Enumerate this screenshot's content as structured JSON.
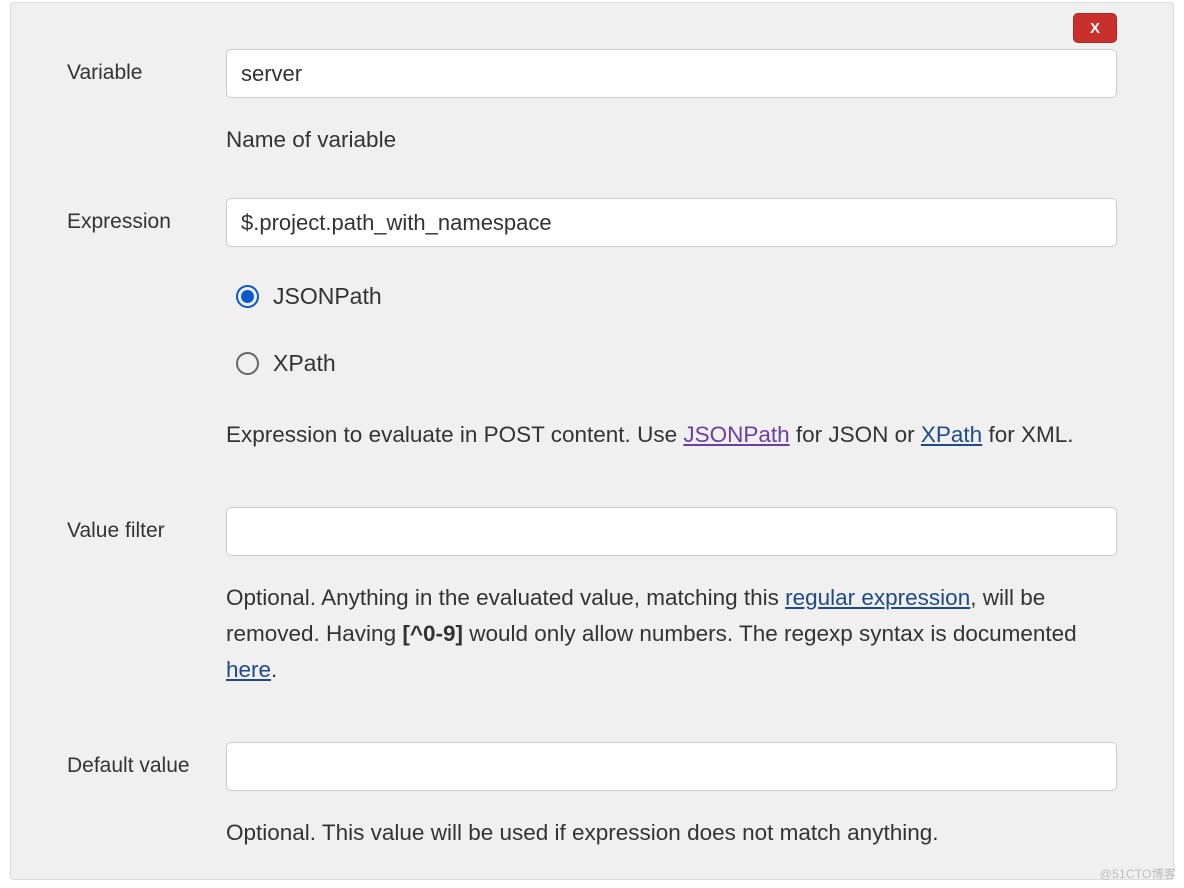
{
  "close_button_label": "X",
  "fields": {
    "variable": {
      "label": "Variable",
      "value": "server",
      "help": "Name of variable"
    },
    "expression": {
      "label": "Expression",
      "value": "$.project.path_with_namespace",
      "radios": {
        "jsonpath": "JSONPath",
        "xpath": "XPath"
      },
      "help_pre": "Expression to evaluate in POST content. Use ",
      "help_link1": "JSONPath",
      "help_mid": " for JSON or ",
      "help_link2": "XPath",
      "help_post": " for XML."
    },
    "value_filter": {
      "label": "Value filter",
      "value": "",
      "help_pre": "Optional. Anything in the evaluated value, matching this ",
      "help_link1": "regular expression",
      "help_mid1": ", will be removed. Having ",
      "help_bold": "[^0-9]",
      "help_mid2": " would only allow numbers. The regexp syntax is documented ",
      "help_link2": "here",
      "help_post": "."
    },
    "default_value": {
      "label": "Default value",
      "value": "",
      "help": "Optional. This value will be used if expression does not match anything."
    }
  },
  "watermark": "@51CTO博客"
}
